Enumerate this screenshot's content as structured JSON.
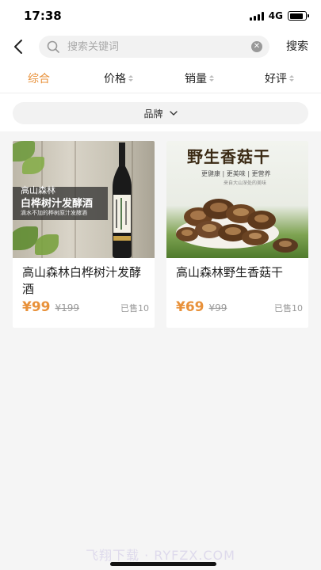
{
  "status_bar": {
    "time": "17:38",
    "network": "4G",
    "battery_level": 0.85,
    "signal_icon": "signal-icon",
    "battery_icon": "battery-icon"
  },
  "search": {
    "placeholder": "搜索关键词",
    "value": "",
    "button_label": "搜索",
    "back_icon": "chevron-left-icon",
    "search_icon": "search-icon",
    "clear_icon": "clear-icon"
  },
  "sort_tabs": [
    {
      "label": "综合",
      "active": true
    },
    {
      "label": "价格",
      "active": false
    },
    {
      "label": "销量",
      "active": false
    },
    {
      "label": "好评",
      "active": false
    }
  ],
  "filter": {
    "brand_label": "品牌",
    "brand_icon": "chevron-down-icon"
  },
  "products": [
    {
      "title": "高山森林白桦树汁发酵酒",
      "price": "¥99",
      "original_price": "¥199",
      "sold": "已售10",
      "image_texts": [
        "高山森林",
        "白桦树汁发酵酒",
        "滴水不加的桦树原汁发酵酒"
      ]
    },
    {
      "title": "高山森林野生香菇干",
      "price": "¥69",
      "original_price": "¥99",
      "sold": "已售10",
      "image_texts": [
        "野生香菇干",
        "更健康 | 更美味 | 更营养",
        "来自大山深处的美味"
      ]
    }
  ],
  "watermark": "飞翔下载 · RYFZX.COM",
  "colors": {
    "accent": "#e8913a",
    "background": "#f5f5f5",
    "card": "#ffffff",
    "muted": "#999999"
  }
}
